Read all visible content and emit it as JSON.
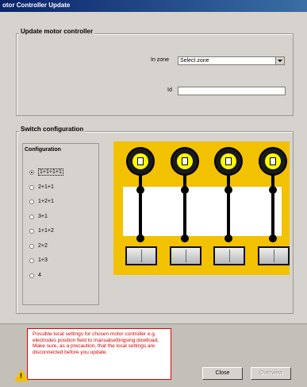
{
  "window": {
    "title": "otor Controller Update"
  },
  "update_group": {
    "title": "Update motor controller",
    "zone_label": "In zone",
    "zone_value": "Select zone",
    "id_label": "Id",
    "id_value": ""
  },
  "switch_group": {
    "title": "Switch configuration",
    "configuration_title": "Configuration",
    "options": [
      "1+1+1+1",
      "2+1+1",
      "1+2+1",
      "3+1",
      "1+1+2",
      "2+2",
      "1+3",
      "4"
    ],
    "selected_index": 0
  },
  "diagram": {
    "background_color": "#f2c100",
    "wheel_color": "#ffff00",
    "motor_count": 4
  },
  "warning": {
    "text": "Possible local settings for chosen motor controller e.g. electrodes position field to manualsettingsing dowtload, Make sure, as a precaution, that the local settings are disconnected before you update."
  },
  "buttons": {
    "close": "Close",
    "update": "Overview"
  }
}
